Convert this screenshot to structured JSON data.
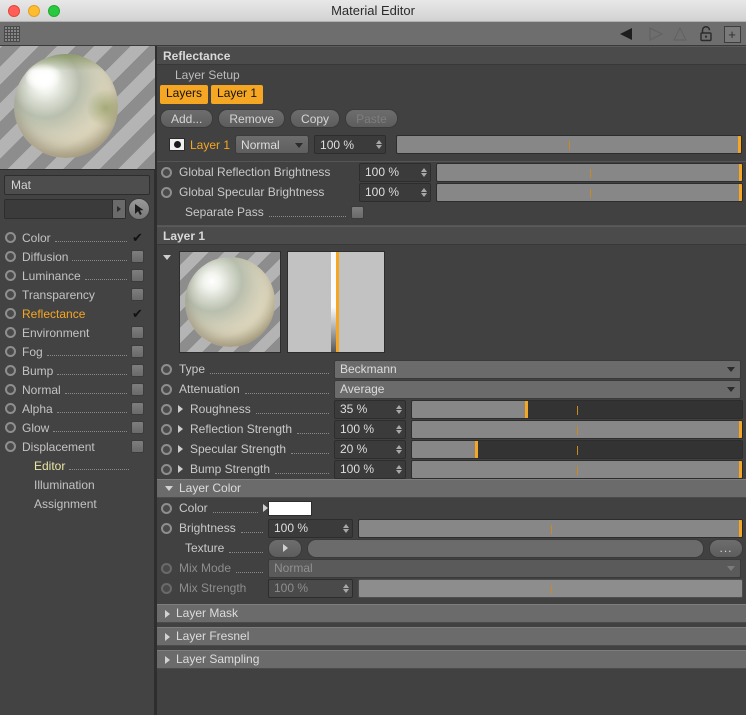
{
  "window": {
    "title": "Material Editor",
    "traffic_lights": [
      "close-button",
      "minimize-button",
      "zoom-button"
    ]
  },
  "toolbar": {
    "grip": "grip-handle",
    "icons": [
      "prev-arrow-icon",
      "next-arrow-icon",
      "tree-icon",
      "lock-icon",
      "add-icon"
    ],
    "lock_glyph": "⚿",
    "add_glyph": "+"
  },
  "left_panel": {
    "material_name": "Mat",
    "search_value": "",
    "channels": [
      {
        "label": "Color",
        "checked": true,
        "active": false,
        "dotted": true
      },
      {
        "label": "Diffusion",
        "checked": false,
        "active": false,
        "dotted": true
      },
      {
        "label": "Luminance",
        "checked": false,
        "active": false,
        "dotted": true
      },
      {
        "label": "Transparency",
        "checked": false,
        "active": false,
        "dotted": false
      },
      {
        "label": "Reflectance",
        "checked": true,
        "active": true,
        "dotted": false
      },
      {
        "label": "Environment",
        "checked": false,
        "active": false,
        "dotted": false
      },
      {
        "label": "Fog",
        "checked": false,
        "active": false,
        "dotted": true
      },
      {
        "label": "Bump",
        "checked": false,
        "active": false,
        "dotted": true
      },
      {
        "label": "Normal",
        "checked": false,
        "active": false,
        "dotted": true
      },
      {
        "label": "Alpha",
        "checked": false,
        "active": false,
        "dotted": true
      },
      {
        "label": "Glow",
        "checked": false,
        "active": false,
        "dotted": true
      },
      {
        "label": "Displacement",
        "checked": false,
        "active": false,
        "dotted": false
      }
    ],
    "sub_items": [
      {
        "label": "Editor",
        "highlight": "editor",
        "dotted": true
      },
      {
        "label": "Illumination",
        "highlight": "none",
        "dotted": false
      },
      {
        "label": "Assignment",
        "highlight": "none",
        "dotted": false
      }
    ]
  },
  "reflectance": {
    "header": "Reflectance",
    "layer_setup_label": "Layer Setup",
    "tabs": [
      "Layers",
      "Layer 1"
    ],
    "buttons": [
      {
        "label": "Add...",
        "enabled": true
      },
      {
        "label": "Remove",
        "enabled": true
      },
      {
        "label": "Copy",
        "enabled": true
      },
      {
        "label": "Paste",
        "enabled": false
      }
    ],
    "layer_row": {
      "name": "Layer 1",
      "blend_mode": "Normal",
      "opacity": "100 %",
      "opacity_pct": 100,
      "tick_pct": 50
    },
    "global_reflection": {
      "label": "Global Reflection Brightness",
      "value": "100 %",
      "pct": 100,
      "tick_pct": 50
    },
    "global_specular": {
      "label": "Global Specular Brightness",
      "value": "100 %",
      "pct": 100,
      "tick_pct": 50
    },
    "separate_pass": {
      "label": "Separate Pass",
      "checked": false
    }
  },
  "layer1": {
    "header": "Layer 1",
    "rows": [
      {
        "label": "Type",
        "kind": "combo",
        "value": "Beckmann",
        "triangle": false,
        "enabled": true
      },
      {
        "label": "Attenuation",
        "kind": "combo",
        "value": "Average",
        "triangle": false,
        "enabled": true
      },
      {
        "label": "Roughness",
        "kind": "slider",
        "value": "35 %",
        "pct": 35,
        "tick_pct": 50,
        "triangle": true,
        "enabled": true
      },
      {
        "label": "Reflection Strength",
        "kind": "slider",
        "value": "100 %",
        "pct": 100,
        "tick_pct": 50,
        "triangle": true,
        "enabled": true
      },
      {
        "label": "Specular Strength",
        "kind": "slider",
        "value": "20 %",
        "pct": 20,
        "tick_pct": 50,
        "triangle": true,
        "enabled": true
      },
      {
        "label": "Bump Strength",
        "kind": "slider",
        "value": "100 %",
        "pct": 100,
        "tick_pct": 50,
        "triangle": true,
        "enabled": true
      }
    ]
  },
  "layer_color": {
    "header": "Layer Color",
    "color": {
      "label": "Color",
      "swatch": "#ffffff"
    },
    "brightness": {
      "label": "Brightness",
      "value": "100 %",
      "pct": 100,
      "tick_pct": 50
    },
    "texture": {
      "label": "Texture",
      "value": "",
      "browse_label": "..."
    },
    "mix_mode": {
      "label": "Mix Mode",
      "value": "Normal",
      "enabled": false
    },
    "mix_strength": {
      "label": "Mix Strength",
      "value": "100 %",
      "pct": 100,
      "tick_pct": 50,
      "enabled": false
    }
  },
  "collapsed_sections": [
    {
      "label": "Layer Mask"
    },
    {
      "label": "Layer Fresnel"
    },
    {
      "label": "Layer Sampling"
    }
  ],
  "colors": {
    "accent_orange": "#f5a623",
    "editor_yellow": "#eae5a2",
    "panel_bg": "#414141",
    "section_header": "#4b4b4b",
    "collapse_header": "#6b6b6b"
  }
}
